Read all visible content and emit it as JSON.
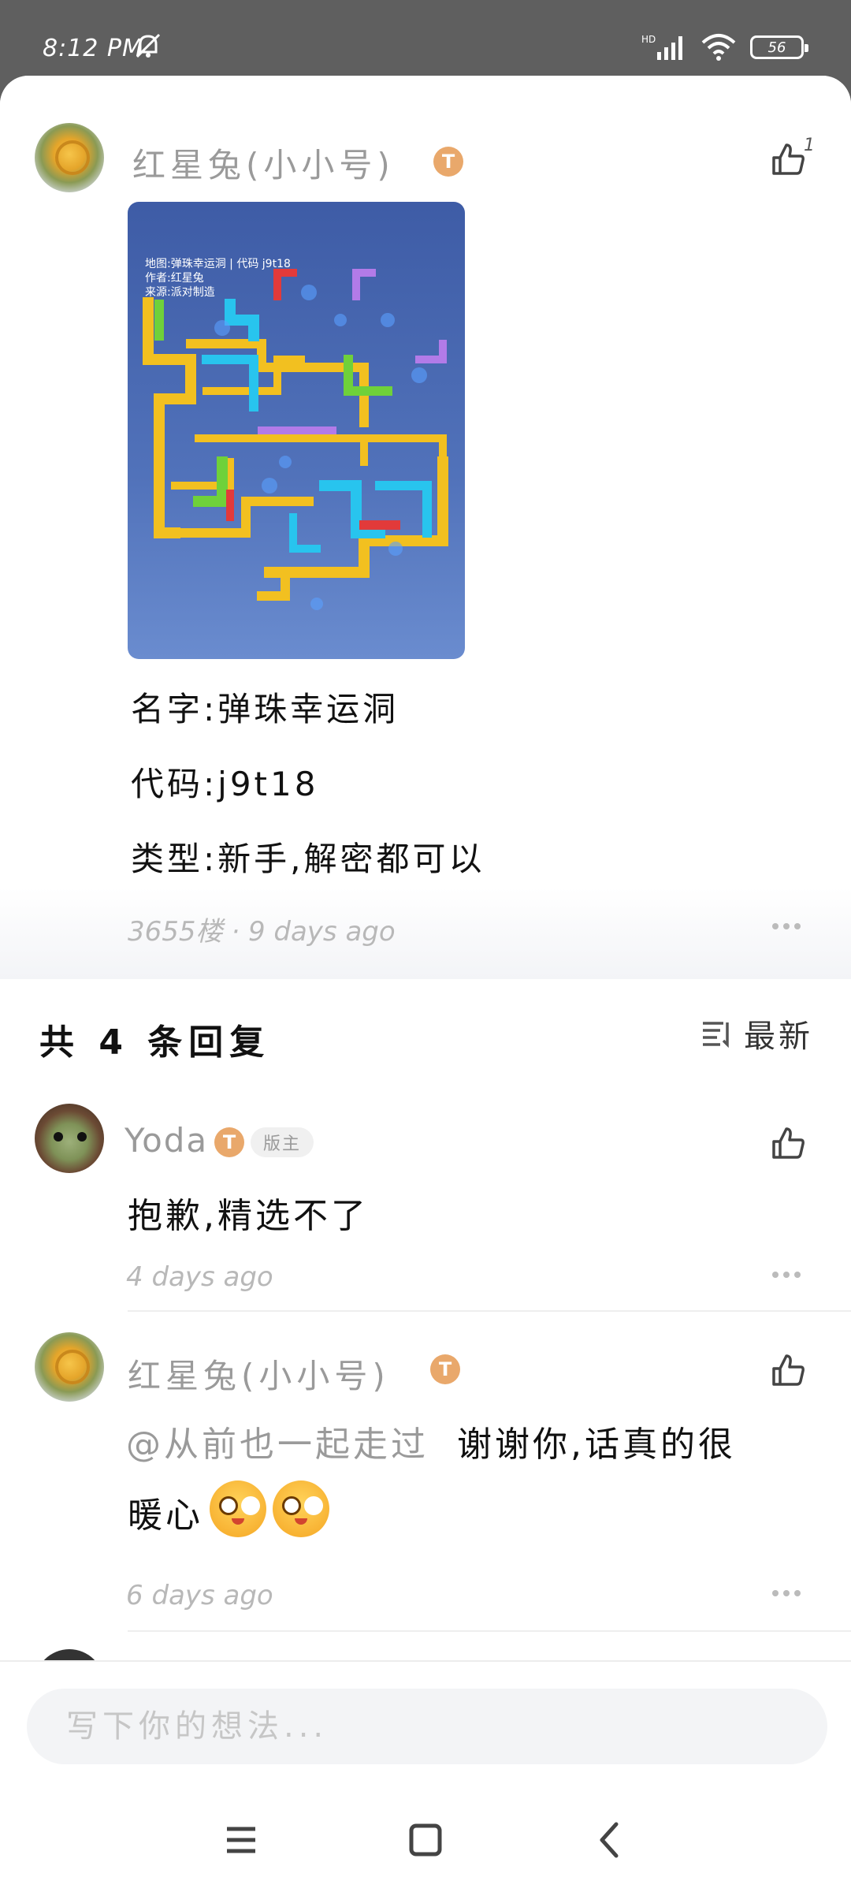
{
  "status_bar": {
    "time": "8:12 PM",
    "network": "HD",
    "battery": "56"
  },
  "post": {
    "author": "红星兔(小小号)",
    "level_badge": "T",
    "like_count": "1",
    "image_caption": "地图:弹珠幸运洞 | 代码 j9t18\n作者:红星兔\n来源:派对制造",
    "lines": [
      "名字:弹珠幸运洞",
      "代码:j9t18",
      "类型:新手,解密都可以"
    ],
    "meta": "3655楼 · 9 days ago"
  },
  "replies_section": {
    "title": "共 4 条回复",
    "sort_label": "最新"
  },
  "replies": [
    {
      "author": "Yoda",
      "level_badge": "T",
      "role_badge": "版主",
      "text": "抱歉,精选不了",
      "time": "4 days ago"
    },
    {
      "author": "红星兔(小小号)",
      "level_badge": "T",
      "mention": "@从前也一起走过",
      "text_line1": "谢谢你,话真的很",
      "text_line2": "暖心",
      "time": "6 days ago"
    }
  ],
  "comment_box": {
    "placeholder": "写下你的想法..."
  },
  "colors": {
    "accent_badge": "#e9a86b",
    "map_bg": "#4a68b2"
  },
  "icons": [
    "do-not-disturb-icon",
    "signal-icon",
    "wifi-icon",
    "battery-icon",
    "thumbs-up-icon",
    "more-icon",
    "sort-icon",
    "menu-icon",
    "home-icon",
    "back-icon"
  ]
}
